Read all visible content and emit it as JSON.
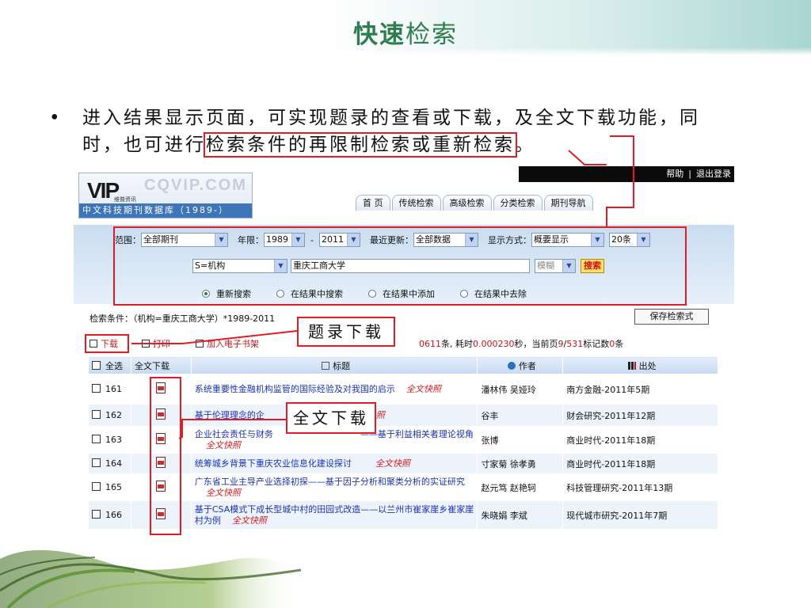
{
  "slide": {
    "title_part1": "快速",
    "title_part2": "检索",
    "bullet_line1": "进入结果显示页面，可实现题录的查看或下载，及全文下载功能，同",
    "bullet_line2_prefix": "时，也可进行",
    "bullet_line2_boxed": "检索条件的再限制检索或重新检索",
    "bullet_line2_suffix": "。"
  },
  "callouts": {
    "record_download": "题录下载",
    "fulltext_download": "全文下载"
  },
  "header": {
    "logo_text": "VIP",
    "logo_sub": "维普资讯",
    "logo_domain": "CQVIP.COM",
    "db_name": "中文科技期刊数据库（1989-）",
    "help": "帮助",
    "separator": "|",
    "logout": "退出登录",
    "tabs": [
      "首 页",
      "传统检索",
      "高级检索",
      "分类检索",
      "期刊导航"
    ]
  },
  "search": {
    "range_label": "范围：",
    "range_value": "全部期刊",
    "year_label": "年限：",
    "year_from": "1989",
    "year_dash": "-",
    "year_to": "2011",
    "update_label": "最近更新：",
    "update_value": "全部数据",
    "display_label": "显示方式：",
    "display_value": "概要显示",
    "count_value": "20条",
    "field_value": "S=机构",
    "query_value": "重庆工商大学",
    "match_value": "模糊",
    "search_button": "搜索",
    "radios": [
      "重新搜索",
      "在结果中搜索",
      "在结果中添加",
      "在结果中去除"
    ],
    "radio_selected": 0
  },
  "condition": "检索条件：（机构=重庆工商大学）*1989-2011",
  "save_button": "保存检索式",
  "toolbar": {
    "download": "下载",
    "print": "打印",
    "add_shelf": "加入电子书架",
    "stats_prefix": "0611",
    "stats_mid1": "条, 耗时",
    "stats_time": "0.000230",
    "stats_mid2": "秒，当前页",
    "stats_page": "9",
    "stats_slash": "/",
    "stats_total_pages": "531",
    "stats_mid3": "标记数",
    "stats_marked": "0",
    "stats_suffix": "条"
  },
  "table": {
    "headers": {
      "select_all": "全选",
      "fulltext": "全文下载",
      "title": "标题",
      "author": "作者",
      "source": "出处"
    },
    "fulltext_tag": "全文快照",
    "rows": [
      {
        "num": "161",
        "title": "系统重要性金融机构监管的国际经验及对我国的启示",
        "ft": "全文快照",
        "author": "潘林伟 吴娅玲",
        "source": "南方金融-2011年5期"
      },
      {
        "num": "162",
        "title": "基于伦理理念的企",
        "ft": "快照",
        "author": "谷丰",
        "source": "财会研究-2011年12期"
      },
      {
        "num": "163",
        "title": "企业社会责任与财务",
        "title_tail": "——基于利益相关者理论视角",
        "ft": "全文快照",
        "author": "张博",
        "source": "商业时代-2011年18期"
      },
      {
        "num": "164",
        "title": "统筹城乡背景下重庆农业信息化建设探讨",
        "ft": "全文快照",
        "author": "寸家菊 徐孝勇",
        "source": "商业时代-2011年18期"
      },
      {
        "num": "165",
        "title": "广东省工业主导产业选择初探——基于因子分析和聚类分析的实证研究",
        "ft": "全文快照",
        "author": "赵元笃 赵艳轲",
        "source": "科技管理研究-2011年13期"
      },
      {
        "num": "166",
        "title": "基于CSA模式下成长型城中村的田园式改造——以兰州市崔家崖乡崔家崖村为例",
        "ft": "全文快照",
        "author": "朱晓娟 李斌",
        "source": "现代城市研究-2011年7期"
      }
    ]
  },
  "colors": {
    "accent_red": "#e21c24",
    "title_green": "#2e7d4f",
    "link_blue": "#1a32b5"
  }
}
